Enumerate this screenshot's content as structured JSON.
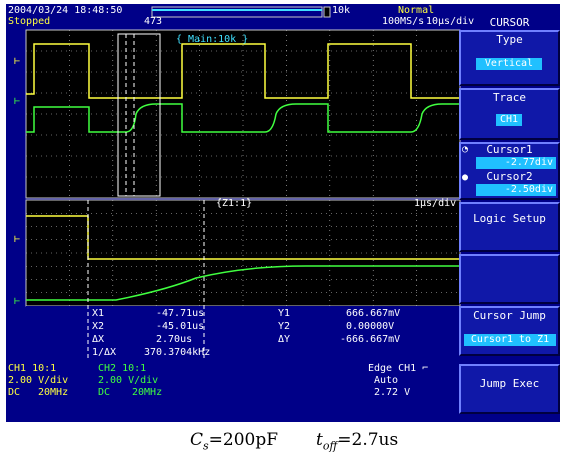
{
  "header": {
    "date": "2004/03/24 18:48:50",
    "state": "Stopped",
    "record": "473",
    "trigger_mode": "Normal",
    "sample_rate": "100MS/s",
    "time_div": "10μs/div",
    "zoom_div": "10k",
    "main_label": "{ Main:10k }",
    "zoom_label": "{Z1:1}",
    "zoom_time_div": "1μs/div"
  },
  "menu": {
    "title": "CURSOR",
    "type_label": "Type",
    "type_value": "Vertical",
    "trace_label": "Trace",
    "trace_value": "CH1",
    "cursor1_label": "Cursor1",
    "cursor1_value": "-2.77div",
    "cursor2_label": "Cursor2",
    "cursor2_value": "-2.50div",
    "logic_setup": "Logic Setup",
    "cursor_jump_label": "Cursor Jump",
    "cursor_jump_value": "Cursor1 to Z1",
    "jump_exec": "Jump Exec"
  },
  "measurements": {
    "x1_label": "X1",
    "x1_value": "-47.71us",
    "x2_label": "X2",
    "x2_value": "-45.01us",
    "dx_label": "ΔX",
    "dx_value": "2.70us",
    "inv_dx_label": "1/ΔX",
    "inv_dx_value": "370.3704kHz",
    "y1_label": "Y1",
    "y1_value": "666.667mV",
    "y2_label": "Y2",
    "y2_value": "0.00000V",
    "dy_label": "ΔY",
    "dy_value": "-666.667mV"
  },
  "channels": {
    "ch1_name": "CH1 10:1",
    "ch1_vdiv": "2.00 V/div",
    "ch1_coupling": "DC",
    "ch1_bw": "20MHz",
    "ch2_name": "CH2 10:1",
    "ch2_vdiv": "2.00 V/div",
    "ch2_coupling": "DC",
    "ch2_bw": "20MHz",
    "trigger": "Edge CH1 ⌐",
    "trigger_mode": "Auto",
    "trigger_level": "2.72 V"
  },
  "caption": {
    "cs_symbol": "C",
    "cs_sub": "s",
    "cs_value": "=200pF",
    "toff_symbol": "t",
    "toff_sub": "off",
    "toff_value": "=2.7us"
  },
  "colors": {
    "background": "#000088",
    "ch1": "#ffff40",
    "ch2": "#40ff40",
    "grid": "#c8c8c8",
    "menu_value": "#20c0ff"
  }
}
